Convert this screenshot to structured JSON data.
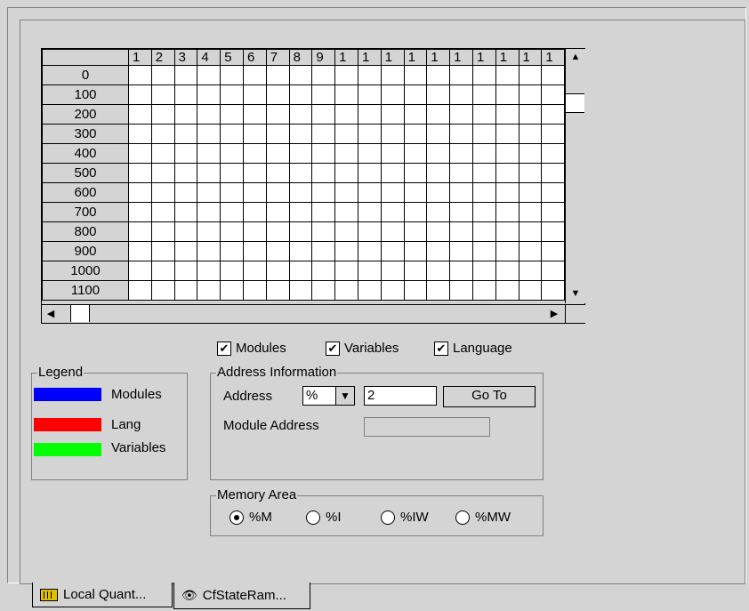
{
  "grid": {
    "column_headers": [
      "1",
      "2",
      "3",
      "4",
      "5",
      "6",
      "7",
      "8",
      "9",
      "1",
      "1",
      "1",
      "1",
      "1",
      "1",
      "1",
      "1",
      "1",
      "1"
    ],
    "row_headers": [
      "0",
      "100",
      "200",
      "300",
      "400",
      "500",
      "600",
      "700",
      "800",
      "900",
      "1000",
      "1100"
    ],
    "scroll_up_icon": "triangle-up",
    "scroll_down_icon": "triangle-down",
    "scroll_left_icon": "triangle-left",
    "scroll_right_icon": "triangle-right"
  },
  "filters": {
    "modules_label": "Modules",
    "variables_label": "Variables",
    "language_label": "Language",
    "modules_checked": true,
    "variables_checked": true,
    "language_checked": true
  },
  "legend": {
    "title": "Legend",
    "items": [
      {
        "label": "Modules",
        "color": "#0000ff"
      },
      {
        "label": "Lang",
        "color": "#ff0000"
      },
      {
        "label": "Variables",
        "color": "#00ff00"
      }
    ]
  },
  "address_info": {
    "title": "Address Information",
    "address_label": "Address",
    "prefix_value": "%",
    "address_value": "2",
    "goto_label": "Go To",
    "module_address_label": "Module Address",
    "module_address_value": ""
  },
  "memory_area": {
    "title": "Memory Area",
    "options": [
      "%M",
      "%I",
      "%IW",
      "%MW"
    ],
    "selected": "%M"
  },
  "tabs": [
    {
      "label": "Local Quant...",
      "icon": "plc-module-icon"
    },
    {
      "label": "CfStateRam...",
      "icon": "eye-icon"
    }
  ]
}
